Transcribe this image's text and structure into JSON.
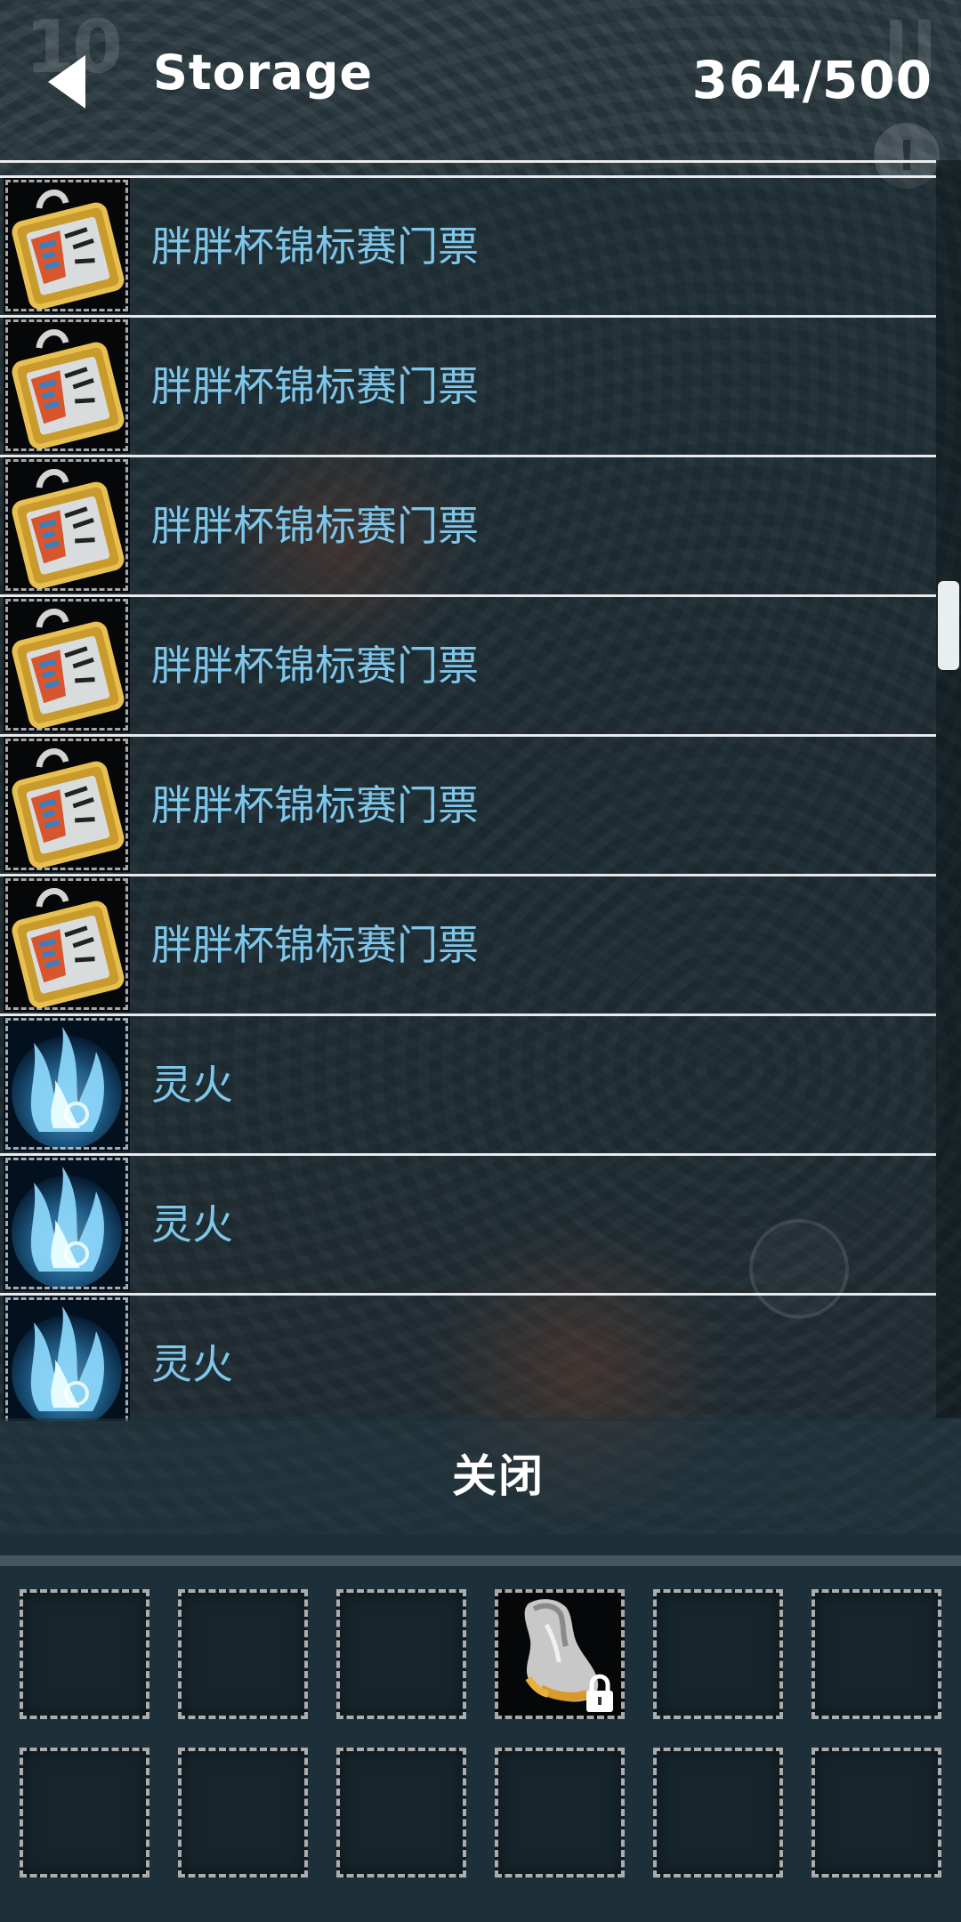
{
  "header": {
    "title": "Storage",
    "count": "364/500"
  },
  "storage": {
    "items": [
      {
        "name": "胖胖杯锦标赛门票",
        "icon": "ticket-icon"
      },
      {
        "name": "胖胖杯锦标赛门票",
        "icon": "ticket-icon"
      },
      {
        "name": "胖胖杯锦标赛门票",
        "icon": "ticket-icon"
      },
      {
        "name": "胖胖杯锦标赛门票",
        "icon": "ticket-icon"
      },
      {
        "name": "胖胖杯锦标赛门票",
        "icon": "ticket-icon"
      },
      {
        "name": "胖胖杯锦标赛门票",
        "icon": "ticket-icon"
      },
      {
        "name": "灵火",
        "icon": "spirit-fire-icon"
      },
      {
        "name": "灵火",
        "icon": "spirit-fire-icon"
      },
      {
        "name": "灵火",
        "icon": "spirit-fire-icon"
      }
    ],
    "scroll_fraction": 0.36
  },
  "close_button": {
    "label": "关闭"
  },
  "inventory": {
    "slots": [
      {
        "item": null
      },
      {
        "item": null
      },
      {
        "item": null
      },
      {
        "item": "boots-icon",
        "locked": true
      },
      {
        "item": null
      },
      {
        "item": null
      },
      {
        "item": null
      },
      {
        "item": null
      },
      {
        "item": null
      },
      {
        "item": null
      },
      {
        "item": null
      },
      {
        "item": null
      }
    ]
  },
  "background": {
    "level_text": "10"
  },
  "colors": {
    "item_name": "#7ec6ea",
    "header_text": "#ffffff",
    "panel": "#1d2f38"
  }
}
